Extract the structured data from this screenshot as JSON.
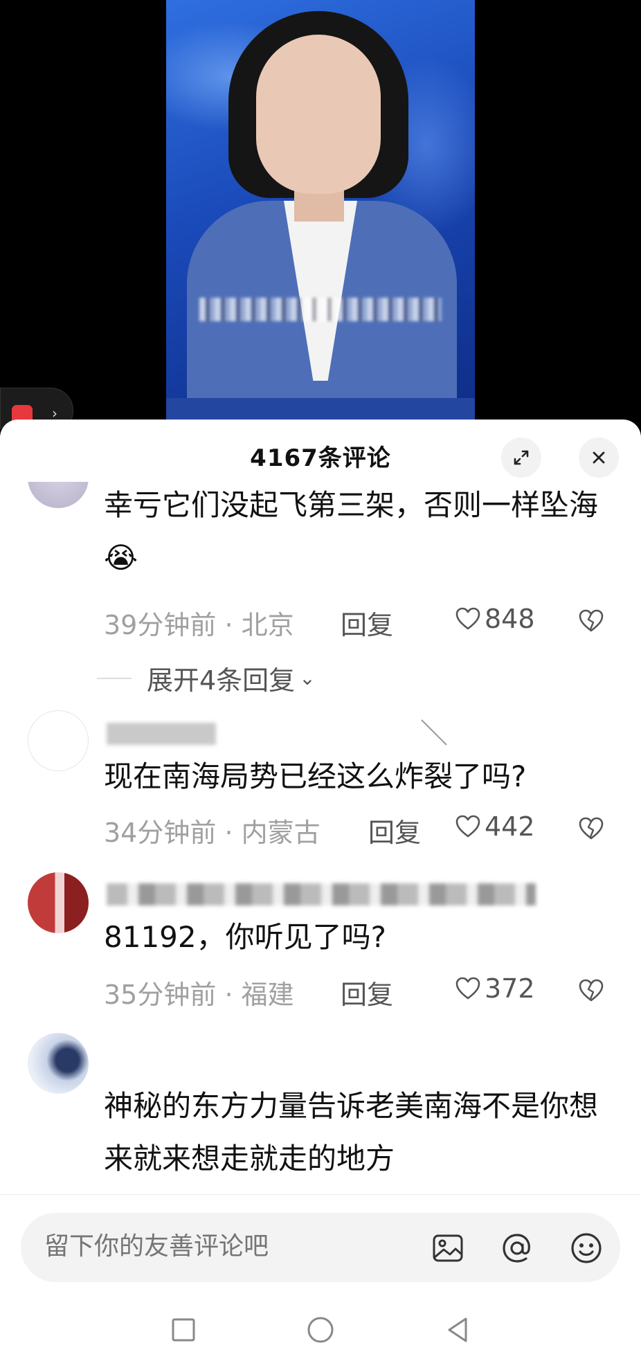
{
  "sheet": {
    "title": "4167条评论",
    "expand_icon": "expand-icon",
    "close_icon": "close-icon"
  },
  "comments": [
    {
      "text": "幸亏它们没起飞第三架，否则一样坠海😭",
      "time": "39分钟前",
      "location": "北京",
      "reply_label": "回复",
      "likes": "848",
      "expand_label": "展开4条回复"
    },
    {
      "text": "现在南海局势已经这么炸裂了吗?",
      "time": "34分钟前",
      "location": "内蒙古",
      "reply_label": "回复",
      "likes": "442"
    },
    {
      "text": "81192，你听见了吗?",
      "time": "35分钟前",
      "location": "福建",
      "reply_label": "回复",
      "likes": "372"
    },
    {
      "text": "神秘的东方力量告诉老美南海不是你想来就来想走就走的地方"
    }
  ],
  "input": {
    "placeholder": "留下你的友善评论吧",
    "icons": [
      "image-icon",
      "at-icon",
      "emoji-icon"
    ]
  },
  "system_nav": [
    "recent-apps-icon",
    "home-icon",
    "back-icon"
  ],
  "colors": {
    "meta": "#a0a0a0",
    "text": "#111111",
    "accent_video_bg": "#1a49b8"
  }
}
